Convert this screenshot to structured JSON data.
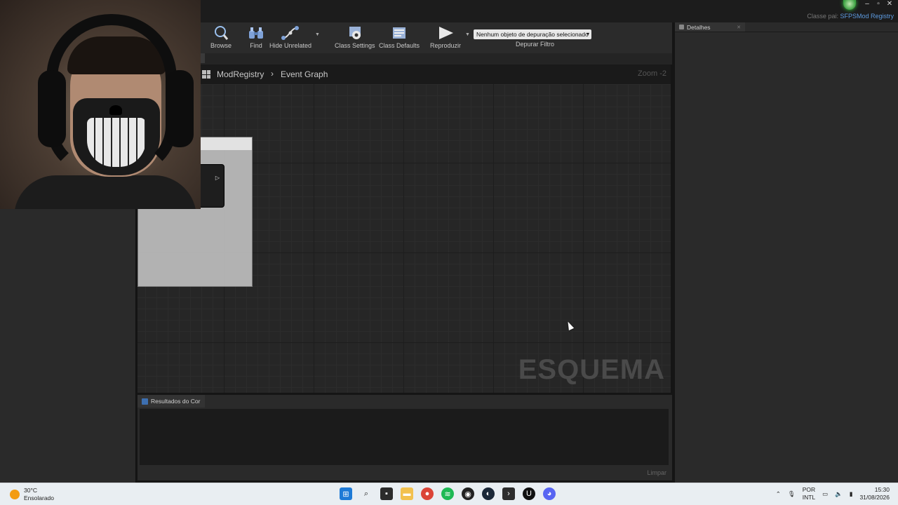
{
  "window": {
    "parent_class_prefix": "Classe pai:",
    "parent_class_value": "SFPSMod Registry"
  },
  "toolbar": {
    "items": [
      {
        "label": "Browse",
        "icon": "browse-icon"
      },
      {
        "label": "Find",
        "icon": "find-icon"
      },
      {
        "label": "Hide Unrelated",
        "icon": "hide-unrelated-icon"
      },
      {
        "label": "Class Settings",
        "icon": "gear-icon"
      },
      {
        "label": "Class Defaults",
        "icon": "class-defaults-icon"
      },
      {
        "label": "Reproduzir",
        "icon": "play-icon"
      }
    ],
    "debug_select_value": "Nenhum objeto de depuração selecionado",
    "debug_filter_label": "Depurar Filtro"
  },
  "graph": {
    "breadcrumb": [
      "ModRegistry",
      "Event Graph"
    ],
    "zoom": "Zoom -2",
    "watermark": "ESQUEMA"
  },
  "results": {
    "tab_label": "Resultados do Cor",
    "clear_label": "Limpar"
  },
  "details": {
    "tab_label": "Detalhes"
  },
  "taskbar": {
    "weather_temp": "30°C",
    "weather_desc": "Ensolarado",
    "icons": [
      "windows-start-icon",
      "search-icon",
      "task-view-icon",
      "file-explorer-icon",
      "chrome-icon",
      "spotify-icon",
      "github-icon",
      "steam-icon",
      "terminal-icon",
      "unreal-engine-icon",
      "discord-icon"
    ],
    "lang_top": "POR",
    "lang_bottom": "INTL",
    "time": "15:30",
    "date": "31/08/2026"
  }
}
